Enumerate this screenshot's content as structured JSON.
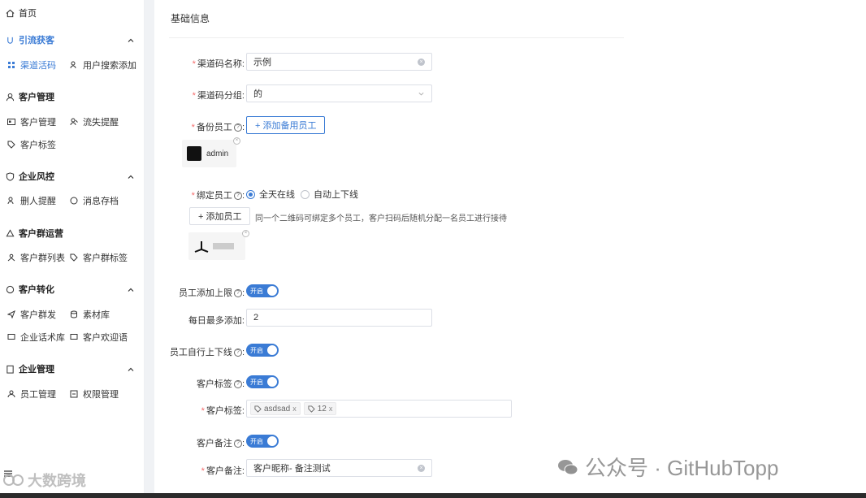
{
  "sidebar": {
    "home": "首页",
    "groups": [
      {
        "title": "引流获客",
        "items": [
          "渠道活码",
          "用户搜索添加"
        ]
      },
      {
        "title": "客户管理",
        "items": [
          "客户管理",
          "流失提醒",
          "客户标签"
        ]
      },
      {
        "title": "企业风控",
        "items": [
          "删人提醒",
          "消息存档"
        ]
      },
      {
        "title": "客户群运营",
        "items": [
          "客户群列表",
          "客户群标签"
        ]
      },
      {
        "title": "客户转化",
        "items": [
          "客户群发",
          "素材库",
          "企业话术库",
          "客户欢迎语"
        ]
      },
      {
        "title": "企业管理",
        "items": [
          "员工管理",
          "权限管理"
        ]
      }
    ],
    "accent": "#3a7bd5"
  },
  "form": {
    "section_title": "基础信息",
    "channel_name_label": "渠道码名称:",
    "channel_name_value": "示例",
    "channel_group_label": "渠道码分组:",
    "channel_group_value": "的",
    "backup_staff_label": "备份员工",
    "add_backup_button": "+ 添加备用员工",
    "backup_staff_name": "admin",
    "bind_staff_label": "绑定员工",
    "radio_all_day": "全天在线",
    "radio_auto": "自动上下线",
    "add_staff_button": "+ 添加员工",
    "add_staff_hint": "同一个二维码可绑定多个员工，客户扫码后随机分配一名员工进行接待",
    "staff_limit_label": "员工添加上限",
    "switch_on_text": "开启",
    "daily_max_label": "每日最多添加:",
    "daily_max_value": "2",
    "self_online_label": "员工自行上下线",
    "customer_tag_label": "客户标签",
    "customer_tag_field_label": "客户标签:",
    "tags": [
      "asdsad",
      "12"
    ],
    "customer_note_label": "客户备注",
    "customer_note_field_label": "客户备注:",
    "customer_note_value": "客户昵称- 备注测试"
  },
  "watermarks": {
    "left": "大数跨境",
    "right": "公众号 · GitHubTopp"
  }
}
